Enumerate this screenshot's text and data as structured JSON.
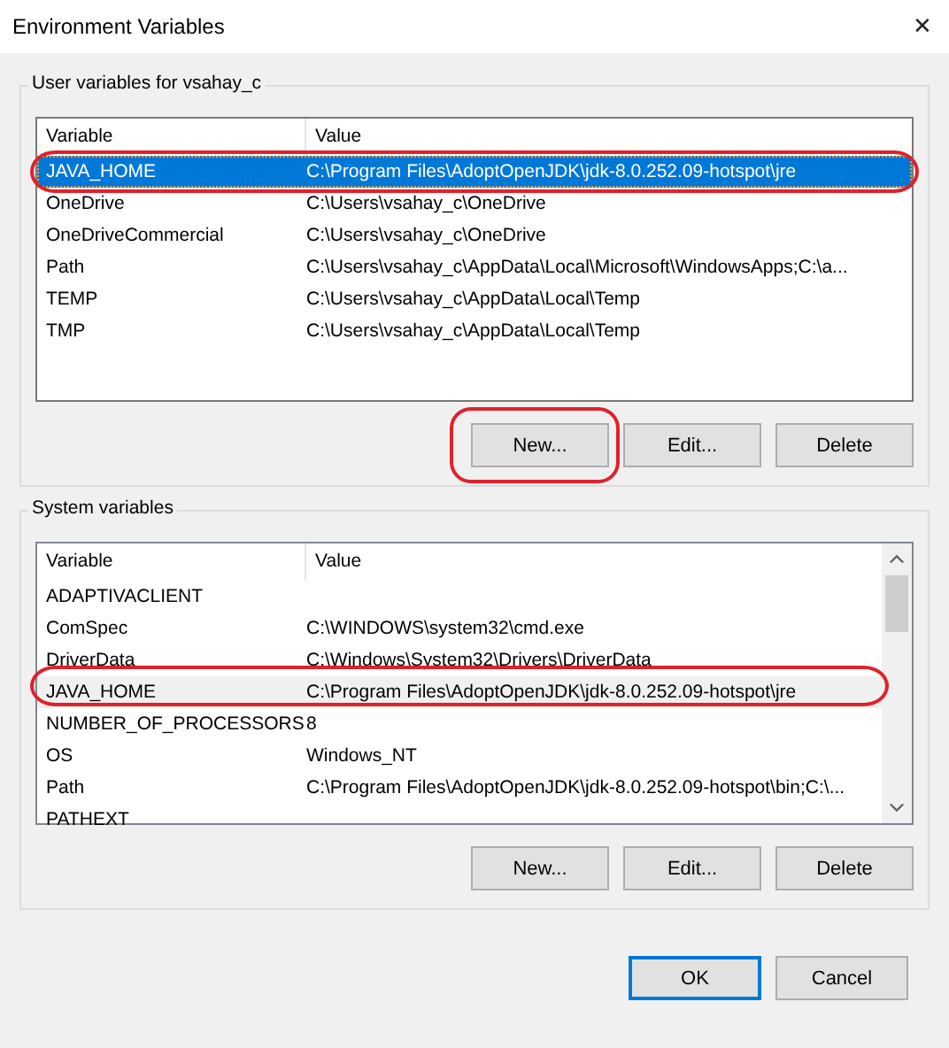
{
  "window": {
    "title": "Environment Variables",
    "close": "✕"
  },
  "groups": [
    {
      "title": "User variables for vsahay_c",
      "focused": true,
      "scrollbar": false,
      "columns": [
        "Variable",
        "Value"
      ],
      "rows": [
        {
          "name": "JAVA_HOME",
          "value": "C:\\Program Files\\AdoptOpenJDK\\jdk-8.0.252.09-hotspot\\jre",
          "selected": true,
          "annotated": true
        },
        {
          "name": "OneDrive",
          "value": "C:\\Users\\vsahay_c\\OneDrive",
          "selected": false,
          "annotated": false
        },
        {
          "name": "OneDriveCommercial",
          "value": "C:\\Users\\vsahay_c\\OneDrive",
          "selected": false,
          "annotated": false
        },
        {
          "name": "Path",
          "value": "C:\\Users\\vsahay_c\\AppData\\Local\\Microsoft\\WindowsApps;C:\\a...",
          "selected": false,
          "annotated": false
        },
        {
          "name": "TEMP",
          "value": "C:\\Users\\vsahay_c\\AppData\\Local\\Temp",
          "selected": false,
          "annotated": false
        },
        {
          "name": "TMP",
          "value": "C:\\Users\\vsahay_c\\AppData\\Local\\Temp",
          "selected": false,
          "annotated": false
        }
      ],
      "buttons": [
        {
          "label": "New...",
          "annotated": true
        },
        {
          "label": "Edit..."
        },
        {
          "label": "Delete"
        }
      ]
    },
    {
      "title": "System variables",
      "focused": false,
      "scrollbar": true,
      "columns": [
        "Variable",
        "Value"
      ],
      "rows": [
        {
          "name": "ADAPTIVACLIENT",
          "selected": false,
          "annotated": false
        },
        {
          "name": "ComSpec",
          "value": "C:\\WINDOWS\\system32\\cmd.exe",
          "selected": false,
          "annotated": false
        },
        {
          "name": "DriverData",
          "value": "C:\\Windows\\System32\\Drivers\\DriverData",
          "selected": false,
          "annotated": false
        },
        {
          "name": "JAVA_HOME",
          "value": "C:\\Program Files\\AdoptOpenJDK\\jdk-8.0.252.09-hotspot\\jre",
          "selected": true,
          "annotated": true
        },
        {
          "name": "NUMBER_OF_PROCESSORS",
          "value": "8",
          "selected": false,
          "annotated": false
        },
        {
          "name": "OS",
          "value": "Windows_NT",
          "selected": false,
          "annotated": false
        },
        {
          "name": "Path",
          "value": "C:\\Program Files\\AdoptOpenJDK\\jdk-8.0.252.09-hotspot\\bin;C:\\...",
          "selected": false,
          "annotated": false
        },
        {
          "name": "PATHEXT",
          "selected": false,
          "annotated": false
        }
      ],
      "buttons": [
        {
          "label": "New..."
        },
        {
          "label": "Edit..."
        },
        {
          "label": "Delete"
        }
      ]
    }
  ],
  "footer": [
    {
      "label": "OK",
      "default": true
    },
    {
      "label": "Cancel",
      "default": false
    }
  ]
}
